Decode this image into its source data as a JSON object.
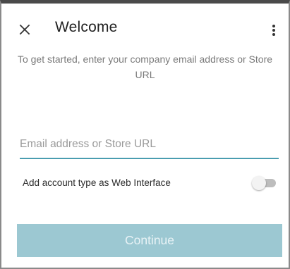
{
  "header": {
    "title": "Welcome",
    "close_icon": "close-icon",
    "menu_icon": "more-vert-icon"
  },
  "intro_text": "To get started, enter your company email address or Store URL",
  "email_input": {
    "value": "",
    "placeholder": "Email address or Store URL"
  },
  "web_interface_toggle": {
    "label": "Add account type as Web Interface",
    "checked": false
  },
  "continue_button": {
    "label": "Continue",
    "enabled": false
  },
  "colors": {
    "accent": "#4a9db0",
    "button_disabled": "#9cc8d2",
    "text_secondary": "#7a7a7a"
  }
}
